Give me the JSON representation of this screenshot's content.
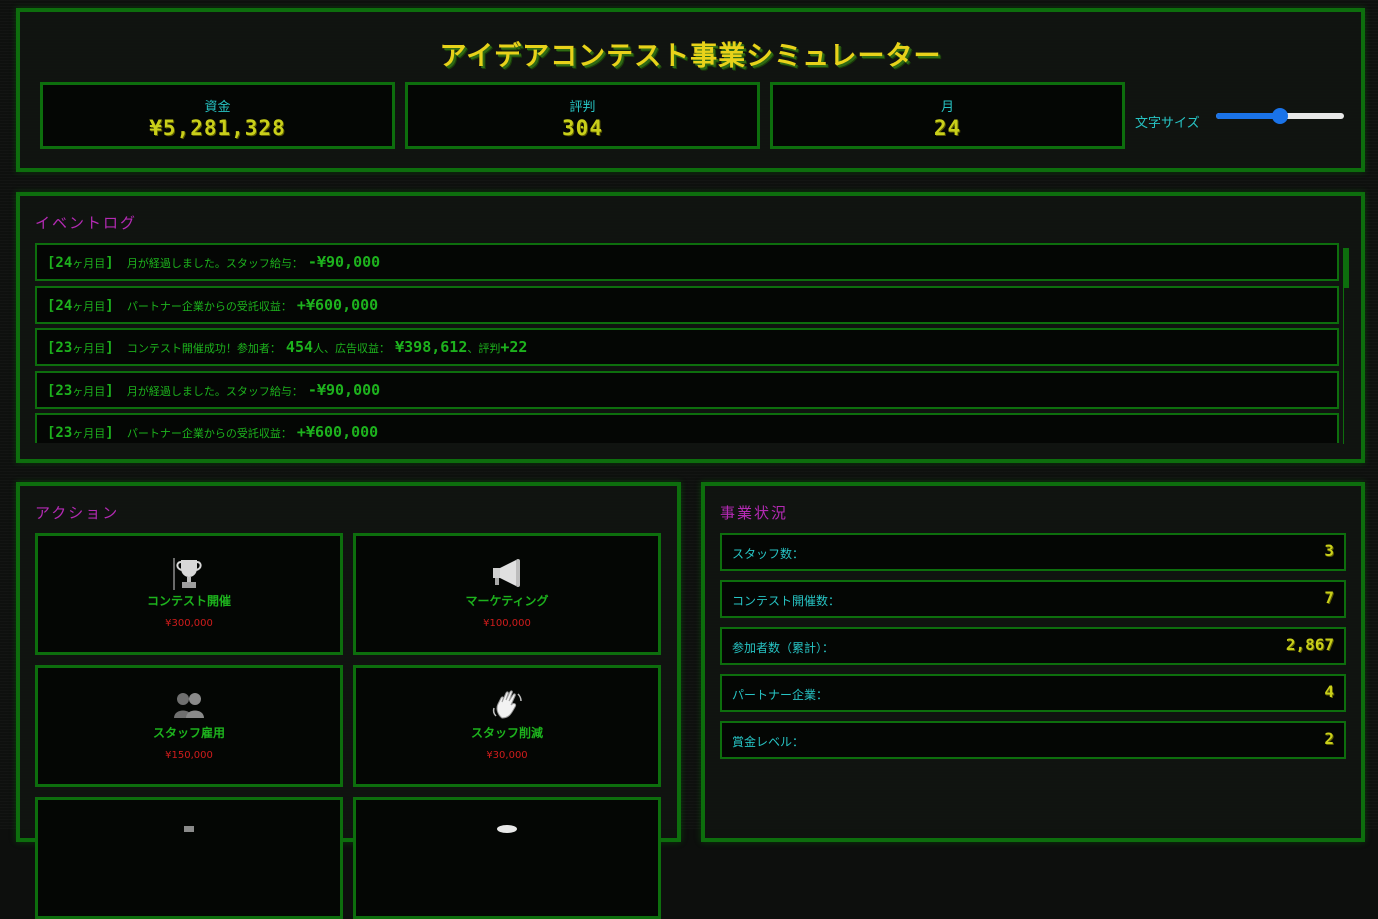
{
  "header": {
    "title": "アイデアコンテスト事業シミュレーター",
    "stats": [
      {
        "label": "資金",
        "value": "¥5,281,328"
      },
      {
        "label": "評判",
        "value": "304"
      },
      {
        "label": "月",
        "value": "24"
      }
    ],
    "font_size_label": "文字サイズ",
    "font_size_level": 0.5
  },
  "event_log": {
    "title": "イベントログ",
    "items": [
      {
        "month": "[24",
        "unit": "ヶ月目",
        "close": "]",
        "text": "月が経過しました。スタッフ給与：",
        "amount": "-¥90,000",
        "extra": ""
      },
      {
        "month": "[24",
        "unit": "ヶ月目",
        "close": "]",
        "text": "パートナー企業からの受託収益：",
        "amount": "+¥600,000",
        "extra": ""
      },
      {
        "month": "[23",
        "unit": "ヶ月目",
        "close": "]",
        "text": "コンテスト開催成功！参加者：",
        "amount": "454",
        "extra_text1": "人、広告収益：",
        "amount2": "¥398,612",
        "extra_text2": "、評判",
        "amount3": "+22"
      },
      {
        "month": "[23",
        "unit": "ヶ月目",
        "close": "]",
        "text": "月が経過しました。スタッフ給与：",
        "amount": "-¥90,000",
        "extra": ""
      },
      {
        "month": "[23",
        "unit": "ヶ月目",
        "close": "]",
        "text": "パートナー企業からの受託収益：",
        "amount": "+¥600,000",
        "extra": ""
      }
    ]
  },
  "actions": {
    "title": "アクション",
    "items": [
      {
        "name": "コンテスト開催",
        "cost": "¥300,000",
        "icon": "trophy-icon"
      },
      {
        "name": "マーケティング",
        "cost": "¥100,000",
        "icon": "megaphone-icon"
      },
      {
        "name": "スタッフ雇用",
        "cost": "¥150,000",
        "icon": "people-icon"
      },
      {
        "name": "スタッフ削減",
        "cost": "¥30,000",
        "icon": "waving-hand-icon"
      }
    ]
  },
  "status": {
    "title": "事業状況",
    "rows": [
      {
        "label": "スタッフ数：",
        "value": "3"
      },
      {
        "label": "コンテスト開催数：",
        "value": "7"
      },
      {
        "label": "参加者数（累計）：",
        "value": "2,867"
      },
      {
        "label": "パートナー企業：",
        "value": "4"
      },
      {
        "label": "賞金レベル：",
        "value": "2"
      }
    ]
  },
  "colors": {
    "border": "#0d6e0d",
    "accent_yellow": "#c9cf1a",
    "cyan": "#27c4c4",
    "magenta": "#b42ab4",
    "green": "#1db21d",
    "cost_red": "#d01c1c",
    "slider_blue": "#1a73e8"
  }
}
